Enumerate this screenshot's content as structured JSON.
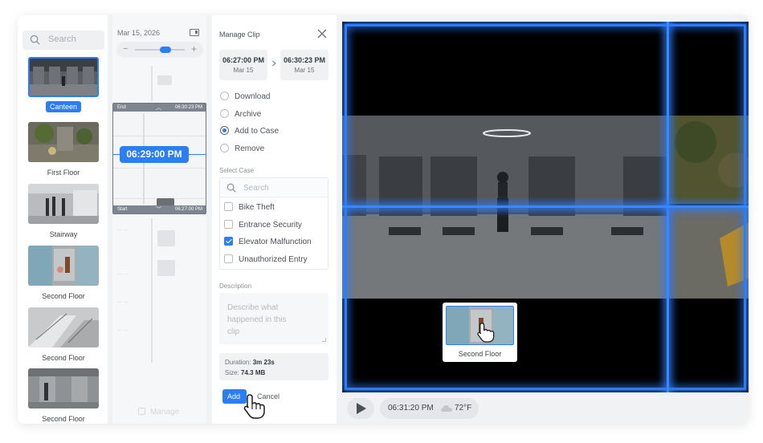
{
  "camera_list": {
    "search_placeholder": "Search",
    "cameras": [
      {
        "name": "Canteen",
        "selected": true
      },
      {
        "name": "First Floor",
        "selected": false
      },
      {
        "name": "Stairway",
        "selected": false
      },
      {
        "name": "Second Floor",
        "selected": false
      },
      {
        "name": "Second Floor",
        "selected": false
      },
      {
        "name": "Second Floor",
        "selected": false
      }
    ]
  },
  "timeline": {
    "date": "Mar 15, 2026",
    "clip_end_label": "End",
    "clip_end_time": "06:30:23 PM",
    "clip_start_label": "Start",
    "clip_start_time": "06:27:00 PM",
    "current_time": "06:29:00 PM",
    "manage_label": "Manage"
  },
  "manage_clip": {
    "title": "Manage Clip",
    "start": {
      "time": "06:27:00 PM",
      "date": "Mar 15"
    },
    "end": {
      "time": "06:30:23 PM",
      "date": "Mar 15"
    },
    "actions": [
      {
        "label": "Download",
        "selected": false
      },
      {
        "label": "Archive",
        "selected": false
      },
      {
        "label": "Add to Case",
        "selected": true
      },
      {
        "label": "Remove",
        "selected": false
      }
    ],
    "select_case_label": "Select Case",
    "case_search_placeholder": "Search",
    "cases": [
      {
        "label": "Bike Theft",
        "checked": false
      },
      {
        "label": "Entrance Security",
        "checked": false
      },
      {
        "label": "Elevator Malfunction",
        "checked": true
      },
      {
        "label": "Unauthorized Entry",
        "checked": false
      }
    ],
    "description_label": "Description",
    "description_placeholder": "Describe what happened in this clip",
    "duration_label": "Duration:",
    "duration_value": "3m 23s",
    "size_label": "Size:",
    "size_value": "74.3 MB",
    "add_button": "Add",
    "cancel_button": "Cancel"
  },
  "video": {
    "popup_camera": "Second Floor",
    "time": "06:31:20 PM",
    "weather_icon": "cloud-icon",
    "temperature": "72°F"
  },
  "colors": {
    "accent": "#2b7ef6",
    "glow": "#2d7cf9"
  }
}
